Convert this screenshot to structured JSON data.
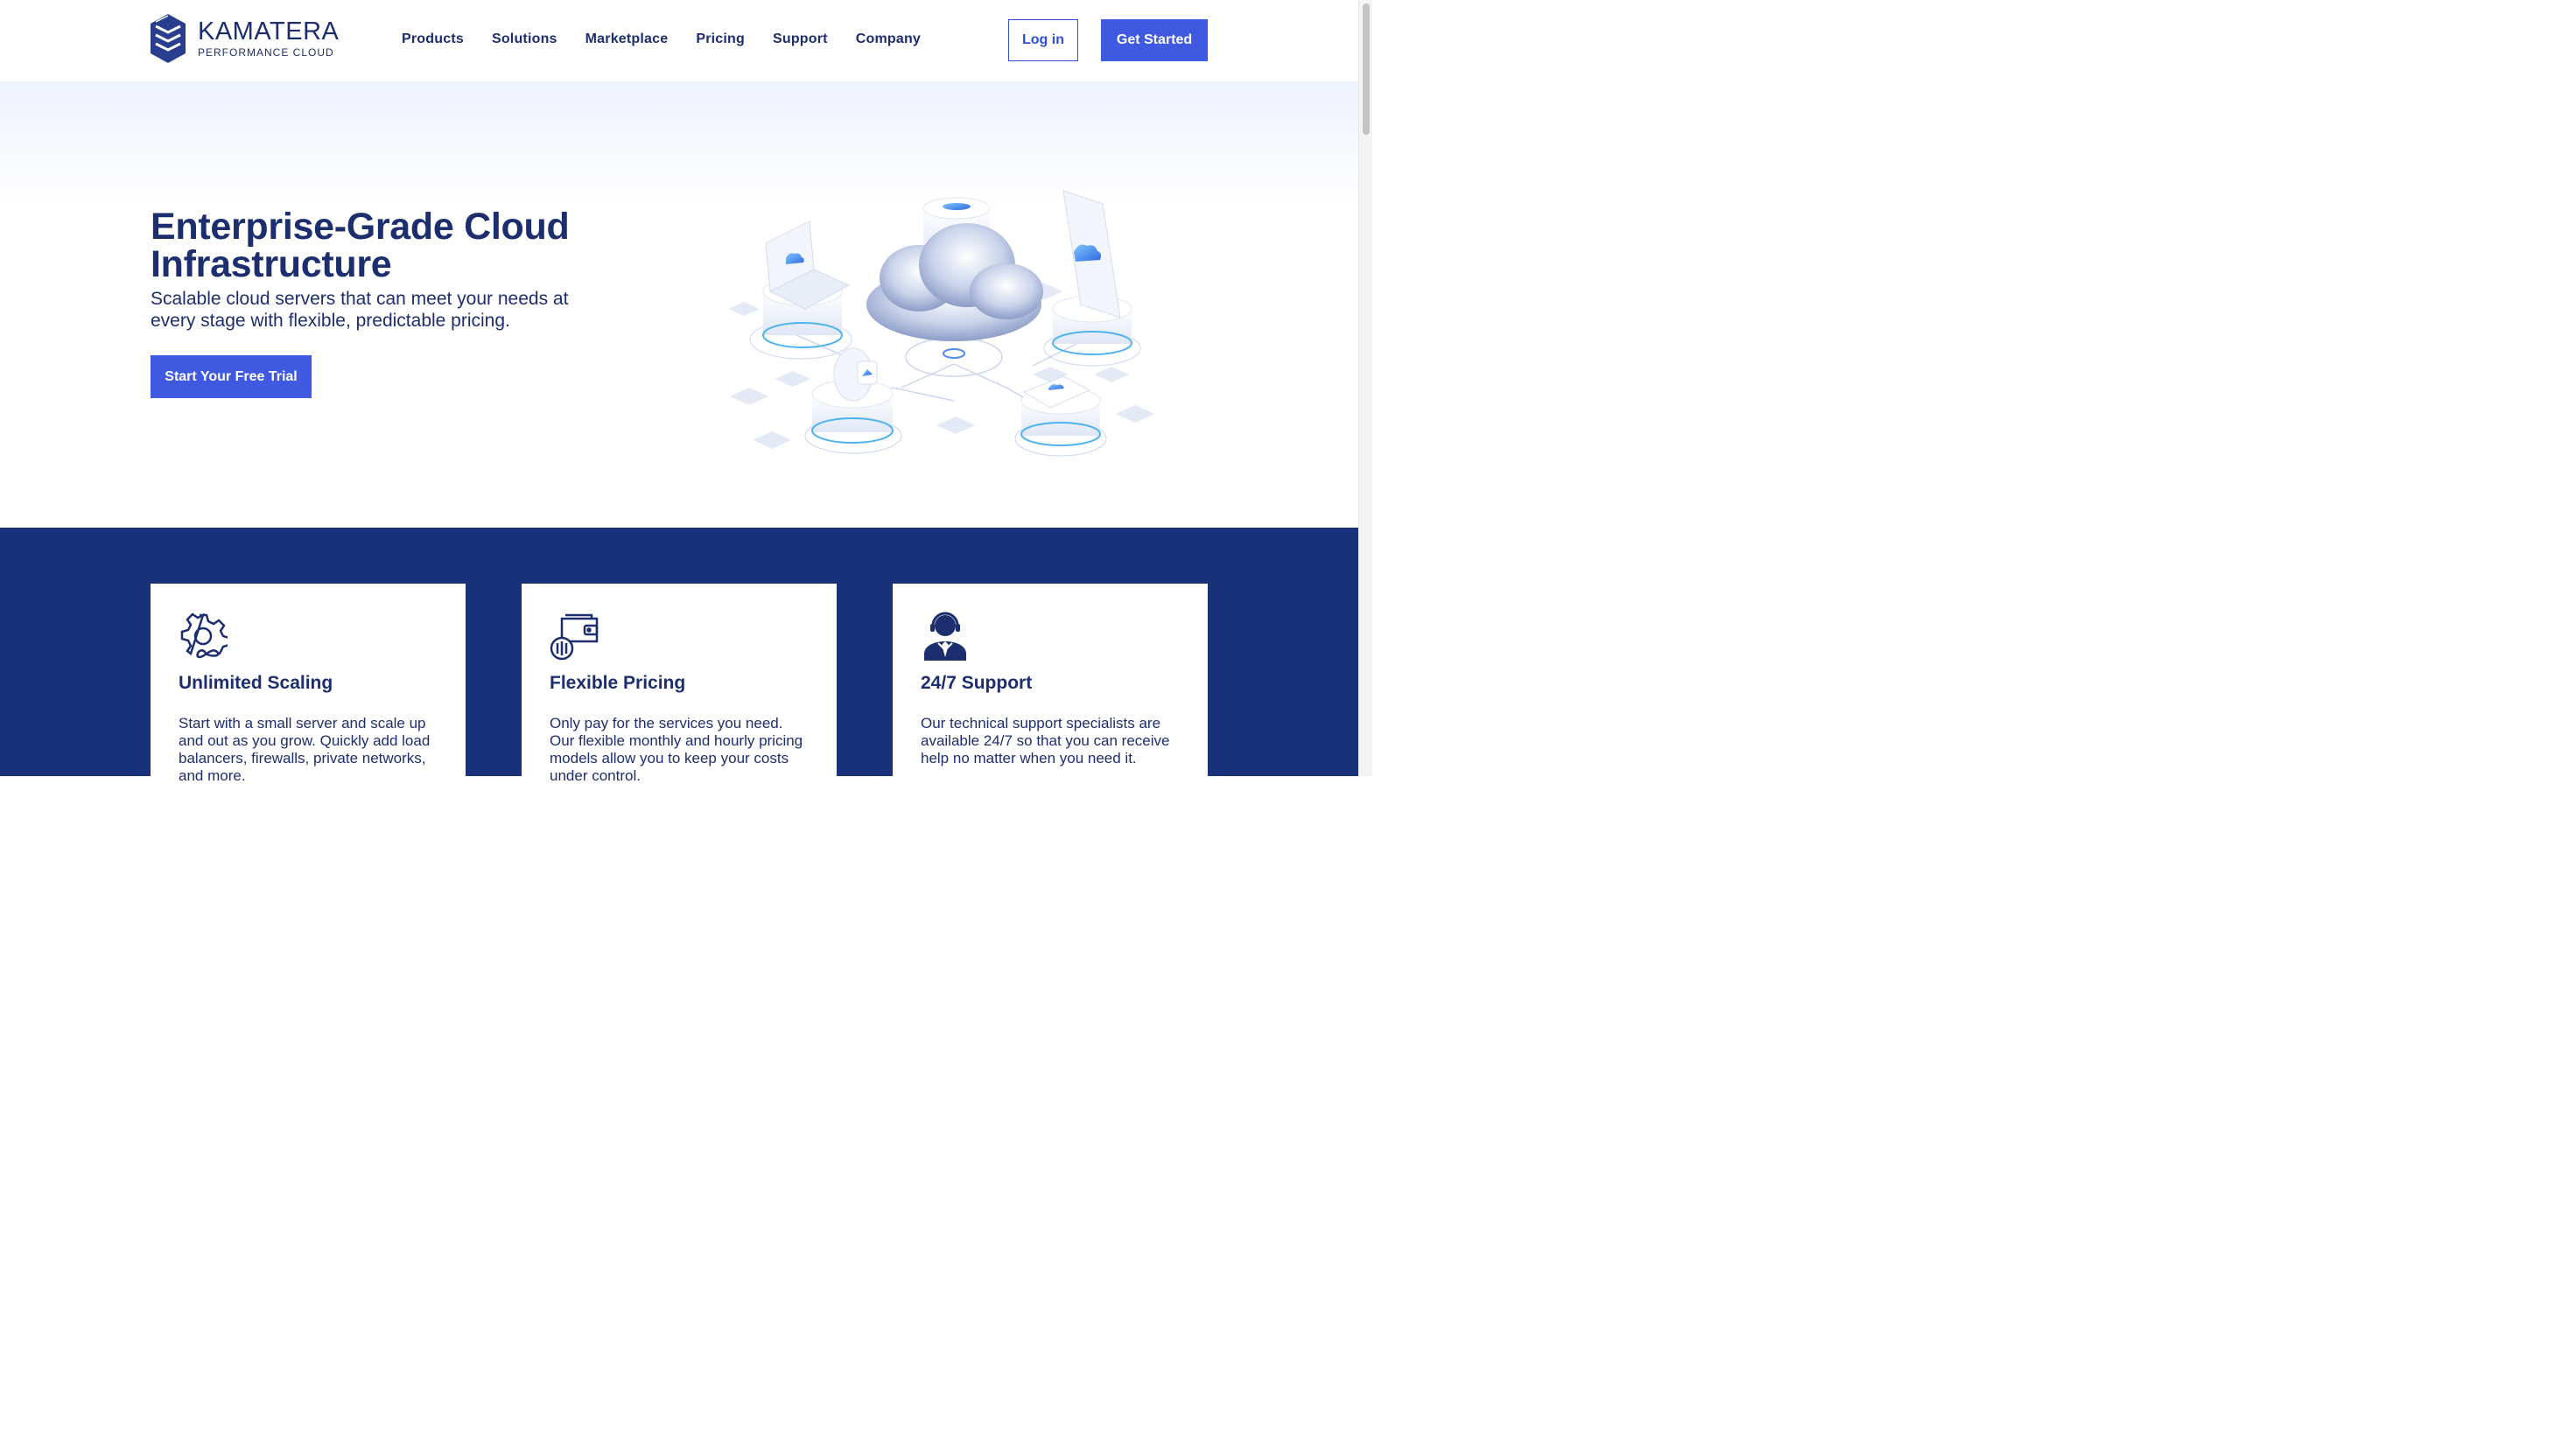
{
  "brand": {
    "name": "KAMATERA",
    "tagline": "PERFORMANCE CLOUD"
  },
  "nav": {
    "items": [
      "Products",
      "Solutions",
      "Marketplace",
      "Pricing",
      "Support",
      "Company"
    ]
  },
  "header_actions": {
    "login": "Log in",
    "get_started": "Get Started"
  },
  "hero": {
    "title": "Enterprise-Grade Cloud Infrastructure",
    "subtitle": "Scalable cloud servers that can meet your needs at every stage with flexible, predictable pricing.",
    "cta": "Start Your Free Trial"
  },
  "features": [
    {
      "icon": "gear-infinity-icon",
      "title": "Unlimited Scaling",
      "text": "Start with a small server and scale up and out as you grow. Quickly add load balancers, firewalls, private networks, and more."
    },
    {
      "icon": "wallet-icon",
      "title": "Flexible Pricing",
      "text": "Only pay for the services you need. Our flexible monthly and hourly pricing models allow you to keep your costs under control."
    },
    {
      "icon": "headset-agent-icon",
      "title": "24/7 Support",
      "text": "Our technical support specialists are available 24/7 so that you can receive help no matter when you need it."
    }
  ],
  "colors": {
    "navy": "#1d2e6e",
    "accent": "#3f5ae0",
    "band": "#19307a"
  }
}
